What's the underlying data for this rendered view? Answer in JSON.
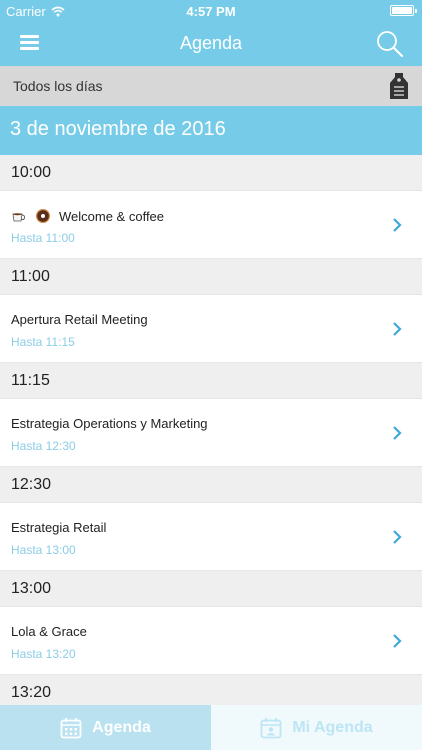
{
  "status_bar": {
    "carrier": "Carrier",
    "time": "4:57 PM"
  },
  "nav": {
    "title": "Agenda",
    "menu_icon": "hamburger-menu-icon",
    "search_icon": "search-icon"
  },
  "filter": {
    "label": "Todos los días",
    "icon": "tag-icon"
  },
  "date_banner": "3 de noviembre de 2016",
  "sections": [
    {
      "time": "10:00",
      "title": "Welcome & coffee",
      "until": "Hasta 11:00",
      "has_emoji": true
    },
    {
      "time": "11:00",
      "title": "Apertura Retail Meeting",
      "until": "Hasta 11:15"
    },
    {
      "time": "11:15",
      "title": "Estrategia Operations y Marketing",
      "until": "Hasta 12:30"
    },
    {
      "time": "12:30",
      "title": "Estrategia Retail",
      "until": "Hasta 13:00"
    },
    {
      "time": "13:00",
      "title": "Lola & Grace",
      "until": "Hasta 13:20"
    },
    {
      "time": "13:20"
    }
  ],
  "tabs": [
    {
      "label": "Agenda",
      "icon": "calendar-icon",
      "active": true
    },
    {
      "label": "Mi Agenda",
      "icon": "personal-calendar-icon",
      "active": false
    }
  ],
  "colors": {
    "accent": "#76cce8",
    "filter_bg": "#d7d7d7",
    "subtitle": "#8bcde6",
    "section_bg": "#efefef"
  }
}
